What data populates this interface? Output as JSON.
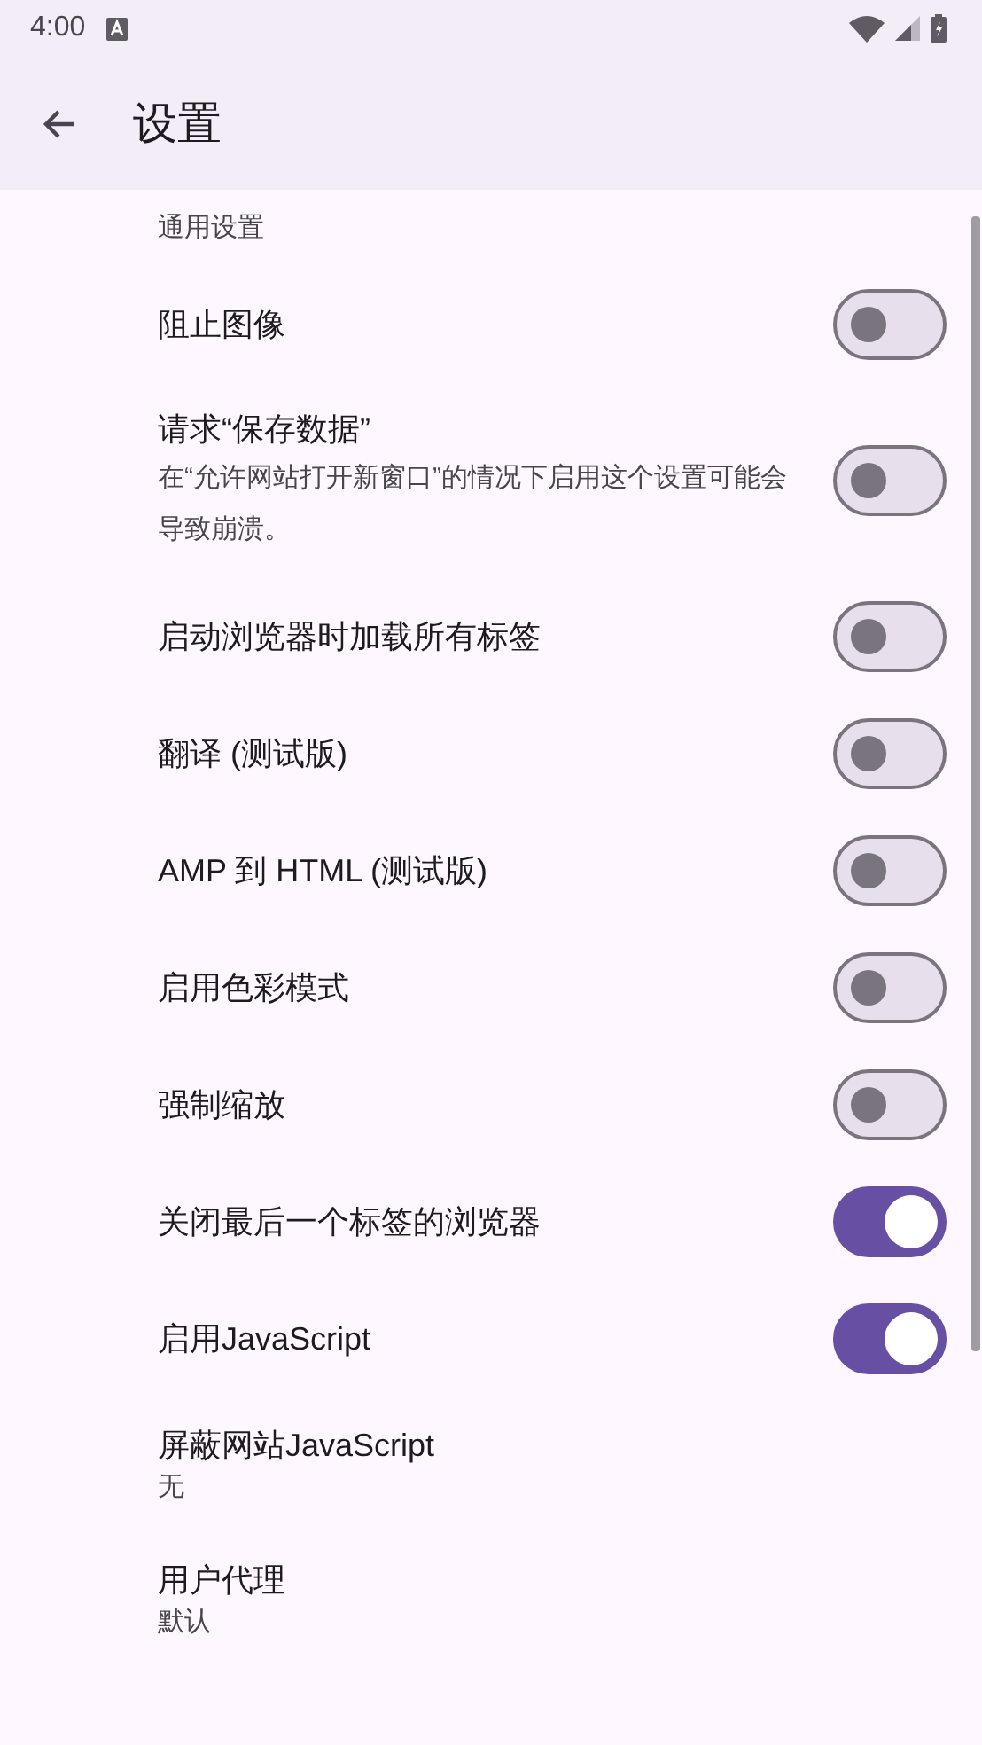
{
  "status_bar": {
    "time": "4:00"
  },
  "app_bar": {
    "title": "设置"
  },
  "section": {
    "title": "通用设置"
  },
  "items": [
    {
      "kind": "switch",
      "title": "阻止图像",
      "on": false
    },
    {
      "kind": "switch",
      "title": "请求“保存数据”",
      "summary": "在“允许网站打开新窗口”的情况下启用这个设置可能会导致崩溃。",
      "on": false
    },
    {
      "kind": "switch",
      "title": "启动浏览器时加载所有标签",
      "on": false
    },
    {
      "kind": "switch",
      "title": "翻译 (测试版)",
      "on": false
    },
    {
      "kind": "switch",
      "title": "AMP 到 HTML (测试版)",
      "on": false
    },
    {
      "kind": "switch",
      "title": "启用色彩模式",
      "on": false
    },
    {
      "kind": "switch",
      "title": "强制缩放",
      "on": false
    },
    {
      "kind": "switch",
      "title": "关闭最后一个标签的浏览器",
      "on": true
    },
    {
      "kind": "switch",
      "title": "启用JavaScript",
      "on": true
    },
    {
      "kind": "value",
      "title": "屏蔽网站JavaScript",
      "summary": "无"
    },
    {
      "kind": "value",
      "title": "用户代理",
      "summary": "默认"
    }
  ]
}
